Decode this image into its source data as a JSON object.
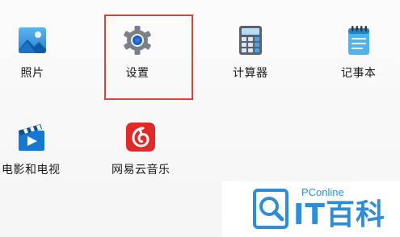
{
  "apps": [
    {
      "id": "photos",
      "label": "照片",
      "icon": "photos-icon"
    },
    {
      "id": "settings",
      "label": "设置",
      "icon": "gear-icon"
    },
    {
      "id": "calculator",
      "label": "计算器",
      "icon": "calculator-icon"
    },
    {
      "id": "notepad",
      "label": "记事本",
      "icon": "notepad-icon"
    },
    {
      "id": "movies",
      "label": "电影和电视",
      "icon": "film-play-icon"
    },
    {
      "id": "music",
      "label": "网易云音乐",
      "icon": "netease-music-icon"
    }
  ],
  "highlight": {
    "target": "settings",
    "color": "#e0403a"
  },
  "watermark": {
    "brand": "PConline",
    "name": "IT百科",
    "color": "#2f8dd8"
  }
}
